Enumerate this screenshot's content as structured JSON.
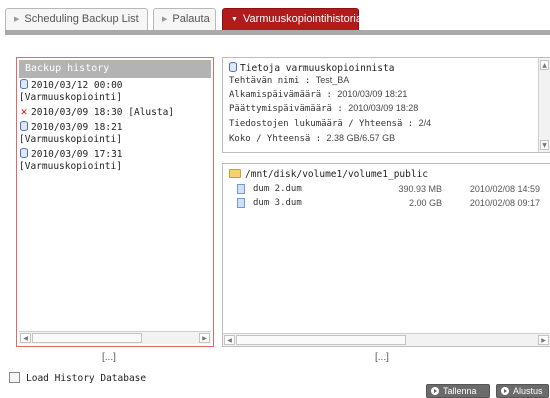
{
  "tabs": [
    {
      "label": "Scheduling Backup List"
    },
    {
      "label": "Palauta"
    },
    {
      "label": "Varmuuskopiointihistoria"
    }
  ],
  "history": {
    "title": "Backup history",
    "items": [
      {
        "status": "ok",
        "date": "2010/03/12 00:00",
        "name": "[Varmuuskopiointi]"
      },
      {
        "status": "error",
        "date": "2010/03/09 18:30",
        "name": "[Alusta]"
      },
      {
        "status": "ok",
        "date": "2010/03/09 18:21",
        "name": "[Varmuuskopiointi]"
      },
      {
        "status": "ok",
        "date": "2010/03/09 17:31",
        "name": "[Varmuuskopiointi]"
      }
    ],
    "more": "[...]"
  },
  "info": {
    "title": "Tietoja varmuuskopioinnista",
    "rows": [
      {
        "label": "Tehtävän nimi :",
        "value": "Test_BA"
      },
      {
        "label": "Alkamispäivämäärä :",
        "value": "2010/03/09 18:21"
      },
      {
        "label": "Päättymispäivämäärä :",
        "value": "2010/03/09 18:28"
      },
      {
        "label": "Tiedostojen lukumäärä / Yhteensä :",
        "value": "2/4"
      },
      {
        "label": "Koko / Yhteensä :",
        "value": "2.38 GB/6.57 GB"
      }
    ]
  },
  "files": {
    "path": "/mnt/disk/volume1/volume1_public",
    "items": [
      {
        "name": "dum 2.dum",
        "size": "390.93 MB",
        "date": "2010/02/08 14:59"
      },
      {
        "name": "dum 3.dum",
        "size": "2.00 GB",
        "date": "2010/02/08 09:17"
      }
    ],
    "more": "[...]"
  },
  "load_history_label": "Load History Database",
  "buttons": {
    "save": "Tallenna",
    "reset": "Alustus"
  },
  "colors": {
    "active_tab": "#b11b1b",
    "header_gray": "#b3b3b3",
    "error_red": "#d41515"
  }
}
